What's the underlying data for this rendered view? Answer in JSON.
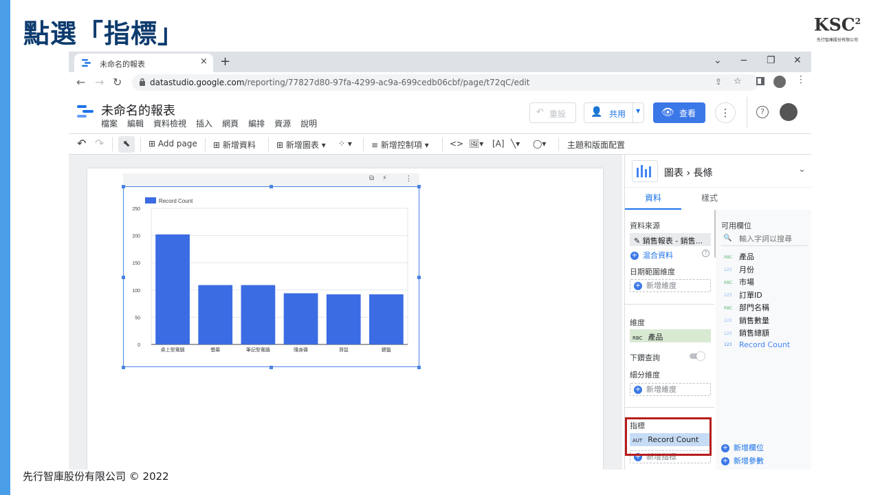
{
  "slide": {
    "title": "點選「指標」",
    "footer": "先行智庫股份有限公司 © 2022",
    "logo_text": "KSC",
    "logo_sup": "2",
    "logo_company": "先行智庫股份有限公司"
  },
  "browser": {
    "tab_title": "未命名的報表",
    "tab_close": "×",
    "new_tab": "+",
    "url_host": "datastudio.google.com",
    "url_path": "/reporting/77827d80-97fa-4299-ac9a-699cedb06cbf/page/t72qC/edit",
    "win": {
      "chevron": "⌄",
      "minimize": "−",
      "restore": "❐",
      "close": "✕"
    }
  },
  "app": {
    "title": "未命名的報表",
    "menu": [
      "檔案",
      "編輯",
      "資料檢視",
      "插入",
      "網頁",
      "編排",
      "資源",
      "說明"
    ],
    "reset": "重設",
    "share": "共用",
    "view": "查看"
  },
  "toolbar": {
    "add_page": "Add page",
    "add_data": "新增資料",
    "add_chart": "新增圖表",
    "add_control": "新增控制項",
    "theme": "主題和版面配置"
  },
  "chart_data": {
    "type": "bar",
    "categories": [
      "桌上型電腦",
      "螢幕",
      "筆記型電腦",
      "隨身碟",
      "滑鼠",
      "鍵盤"
    ],
    "series": [
      {
        "name": "Record Count",
        "values": [
          202,
          109,
          109,
          94,
          92,
          92
        ]
      }
    ],
    "ylim": [
      0,
      250
    ],
    "yticks": [
      0,
      50,
      100,
      150,
      200,
      250
    ],
    "color": "#3b6ce3",
    "legend": "top-left",
    "grid": true
  },
  "panel": {
    "breadcrumb_a": "圖表",
    "breadcrumb_sep": "›",
    "breadcrumb_b": "長條",
    "tab_data": "資料",
    "tab_style": "樣式",
    "data_source_label": "資料來源",
    "data_source": "銷售報表 - 銷售...",
    "blend": "混合資料",
    "date_dim_label": "日期範圍維度",
    "add_dim": "新增維度",
    "dim_label": "維度",
    "dim_type": "RBC",
    "dim_value": "產品",
    "drill_label": "下鑽查詢",
    "breakdown_label": "細分維度",
    "metric_label": "指標",
    "metric_type": "AUT",
    "metric_value": "Record Count",
    "add_metric": "新增指標",
    "avail_label": "可用欄位",
    "search_placeholder": "輸入字詞以搜尋",
    "fields": [
      {
        "type": "RBC",
        "name": "產品"
      },
      {
        "type": "123",
        "name": "月份"
      },
      {
        "type": "RBC",
        "name": "市場"
      },
      {
        "type": "123",
        "name": "訂單ID"
      },
      {
        "type": "RBC",
        "name": "部門名稱"
      },
      {
        "type": "123",
        "name": "銷售數量"
      },
      {
        "type": "123",
        "name": "銷售總額"
      },
      {
        "type": "123",
        "name": "Record Count"
      }
    ],
    "add_field": "新增欄位",
    "add_param": "新增參數"
  }
}
